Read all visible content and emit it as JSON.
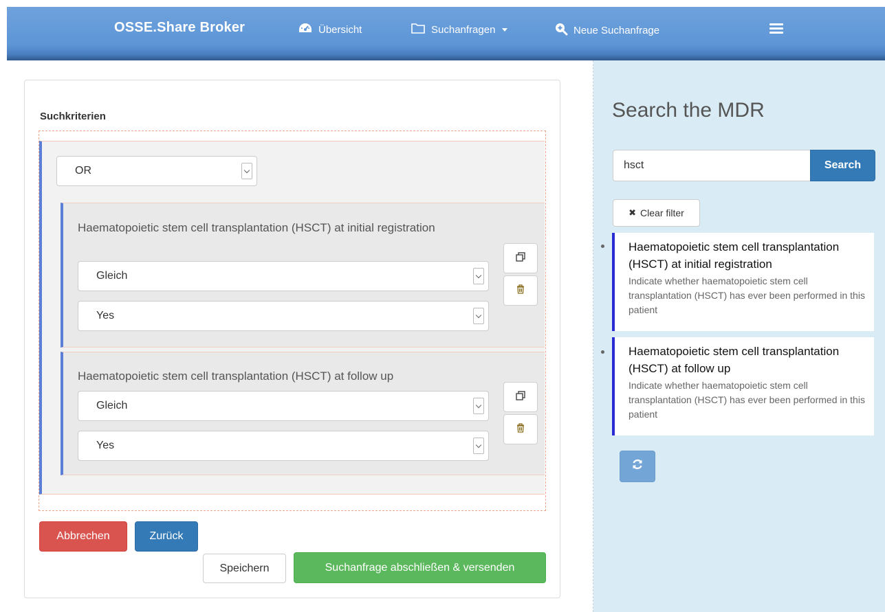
{
  "navbar": {
    "brand_main": "OSSE",
    "brand_sub": ".Share Broker",
    "items": [
      {
        "label": "Übersicht",
        "icon": "dashboard-icon"
      },
      {
        "label": "Suchanfragen",
        "icon": "folder-icon"
      },
      {
        "label": "Neue Suchanfrage",
        "icon": "zoom-in-icon"
      }
    ],
    "menu_icon": "hamburger-icon"
  },
  "query": {
    "section_title": "Suchkriterien",
    "group_operator": "OR",
    "conditions": [
      {
        "label": "Haematopoietic stem cell transplantation (HSCT) at initial registration",
        "operator": "Gleich",
        "value": "Yes"
      },
      {
        "label": "Haematopoietic stem cell transplantation (HSCT) at follow up",
        "operator": "Gleich",
        "value": "Yes"
      }
    ],
    "buttons": {
      "cancel": "Abbrechen",
      "back": "Zurück",
      "save": "Speichern",
      "submit": "Suchanfrage abschließen & versenden"
    }
  },
  "mdr": {
    "title": "Search the MDR",
    "search_value": "hsct",
    "search_button": "Search",
    "clear_filter": "Clear filter",
    "results": [
      {
        "title": "Haematopoietic stem cell transplantation (HSCT) at initial registration",
        "description": "Indicate whether haematopoietic stem cell transplantation (HSCT) has ever been performed in this patient"
      },
      {
        "title": "Haematopoietic stem cell transplantation (HSCT) at follow up",
        "description": "Indicate whether haematopoietic stem cell transplantation (HSCT) has ever been performed in this patient"
      }
    ]
  },
  "colors": {
    "navbar": "#5d95d6",
    "right_panel": "#d9ebf5",
    "primary": "#337ab7",
    "danger": "#d9534f",
    "success": "#5cb85c",
    "group_border": "#5b7ed6",
    "result_border": "#2b2bd2"
  }
}
